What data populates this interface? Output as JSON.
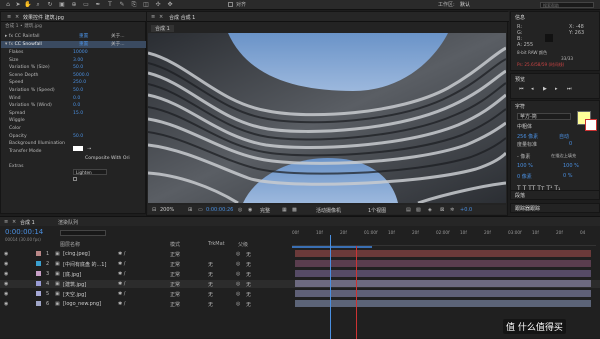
{
  "menubar": {
    "workspace_label": "工作区:",
    "workspace_value": "默认",
    "align_label": "对齐",
    "search_placeholder": "搜索帮助"
  },
  "effects_panel": {
    "tab_label": "效果控件 建筑.jpg",
    "comp_label": "合成 1 • 建筑.jpg",
    "effects": [
      {
        "name": "CC Rainfall",
        "reset": "重置",
        "about": "关于..."
      },
      {
        "name": "CC Snowfall",
        "reset": "重置",
        "about": "关于..."
      }
    ],
    "props": [
      {
        "label": "Flakes",
        "value": "10000"
      },
      {
        "label": "Size",
        "value": "3.00"
      },
      {
        "label": "Variation % (Size)",
        "value": "50.0"
      },
      {
        "label": "Scene Depth",
        "value": "5000.0"
      },
      {
        "label": "Speed",
        "value": "250.0"
      },
      {
        "label": "Variation % (Speed)",
        "value": "50.0"
      },
      {
        "label": "Wind",
        "value": "0.0"
      },
      {
        "label": "Variation % (Wind)",
        "value": "0.0"
      },
      {
        "label": "Spread",
        "value": "15.0"
      },
      {
        "label": "Wiggle",
        "value": ""
      },
      {
        "label": "Color",
        "value": ""
      },
      {
        "label": "Opacity",
        "value": "50.0"
      },
      {
        "label": "Background Illumination",
        "value": ""
      },
      {
        "label": "Transfer Mode",
        "value": "Lighten"
      },
      {
        "label": "",
        "value": "Composite With Ori"
      },
      {
        "label": "Extras",
        "value": ""
      }
    ]
  },
  "comp_panel": {
    "tab_label": "合成 合成 1",
    "sub_tab": "合成 1",
    "zoom": "200%",
    "timecode": "0:00:00:26",
    "resolution": "完整",
    "camera": "活动摄像机",
    "view": "1个视图",
    "exposure": "+0.0"
  },
  "info_panel": {
    "tab": "信息",
    "r": "R:",
    "g": "G:",
    "b": "B:",
    "a": "A: 255",
    "x": "X: -48",
    "y": "Y: 263",
    "colorspace": "8-bit RAW 颜色",
    "frame": "33/33",
    "status": "Ps: 25.6/58/59 (时间线)"
  },
  "preview_panel": {
    "tab": "预览"
  },
  "character_panel": {
    "tab": "字符",
    "font": "苹方-简",
    "style": "中粗体",
    "size": "256 像素",
    "leading": "自动",
    "kerning": "度量标准",
    "tracking": "0",
    "stroke": "- 像素",
    "stroke_type": "在描边上填充",
    "vscale": "100 %",
    "hscale": "100 %",
    "baseline": "0 像素",
    "tsume": "0 %",
    "swatch_color": "#ffff99"
  },
  "paragraph_panel": {
    "tab": "段落"
  },
  "tracker_panel": {
    "tab": "跟踪器跟踪"
  },
  "timeline": {
    "tab1": "合成 1",
    "tab2": "渲染队列",
    "timecode": "0:00:00:14",
    "fps": "00014 (30.00 fps)",
    "headers": {
      "layer_name": "图层名称",
      "mode": "模式",
      "trkmat": "TrkMat",
      "parent": "父级"
    },
    "ruler": [
      "00f",
      "10f",
      "20f",
      "01:00f",
      "10f",
      "20f",
      "02:00f",
      "10f",
      "20f",
      "03:00f",
      "10f",
      "20f",
      "04"
    ],
    "layers": [
      {
        "num": "1",
        "name": "[cing.jpeg]",
        "mode": "正常",
        "trk": "",
        "parent": "无"
      },
      {
        "num": "2",
        "name": "[中间有底盘 的...1]",
        "mode": "正常",
        "trk": "无",
        "parent": "无"
      },
      {
        "num": "3",
        "name": "[底.jpg]",
        "mode": "正常",
        "trk": "无",
        "parent": "无"
      },
      {
        "num": "4",
        "name": "[建筑.jpg]",
        "mode": "正常",
        "trk": "无",
        "parent": "无"
      },
      {
        "num": "5",
        "name": "[天空.jpg]",
        "mode": "正常",
        "trk": "无",
        "parent": "无"
      },
      {
        "num": "6",
        "name": "[logo_new.png]",
        "mode": "正常",
        "trk": "无",
        "parent": "无"
      }
    ]
  },
  "watermark": "值 什么值得买"
}
